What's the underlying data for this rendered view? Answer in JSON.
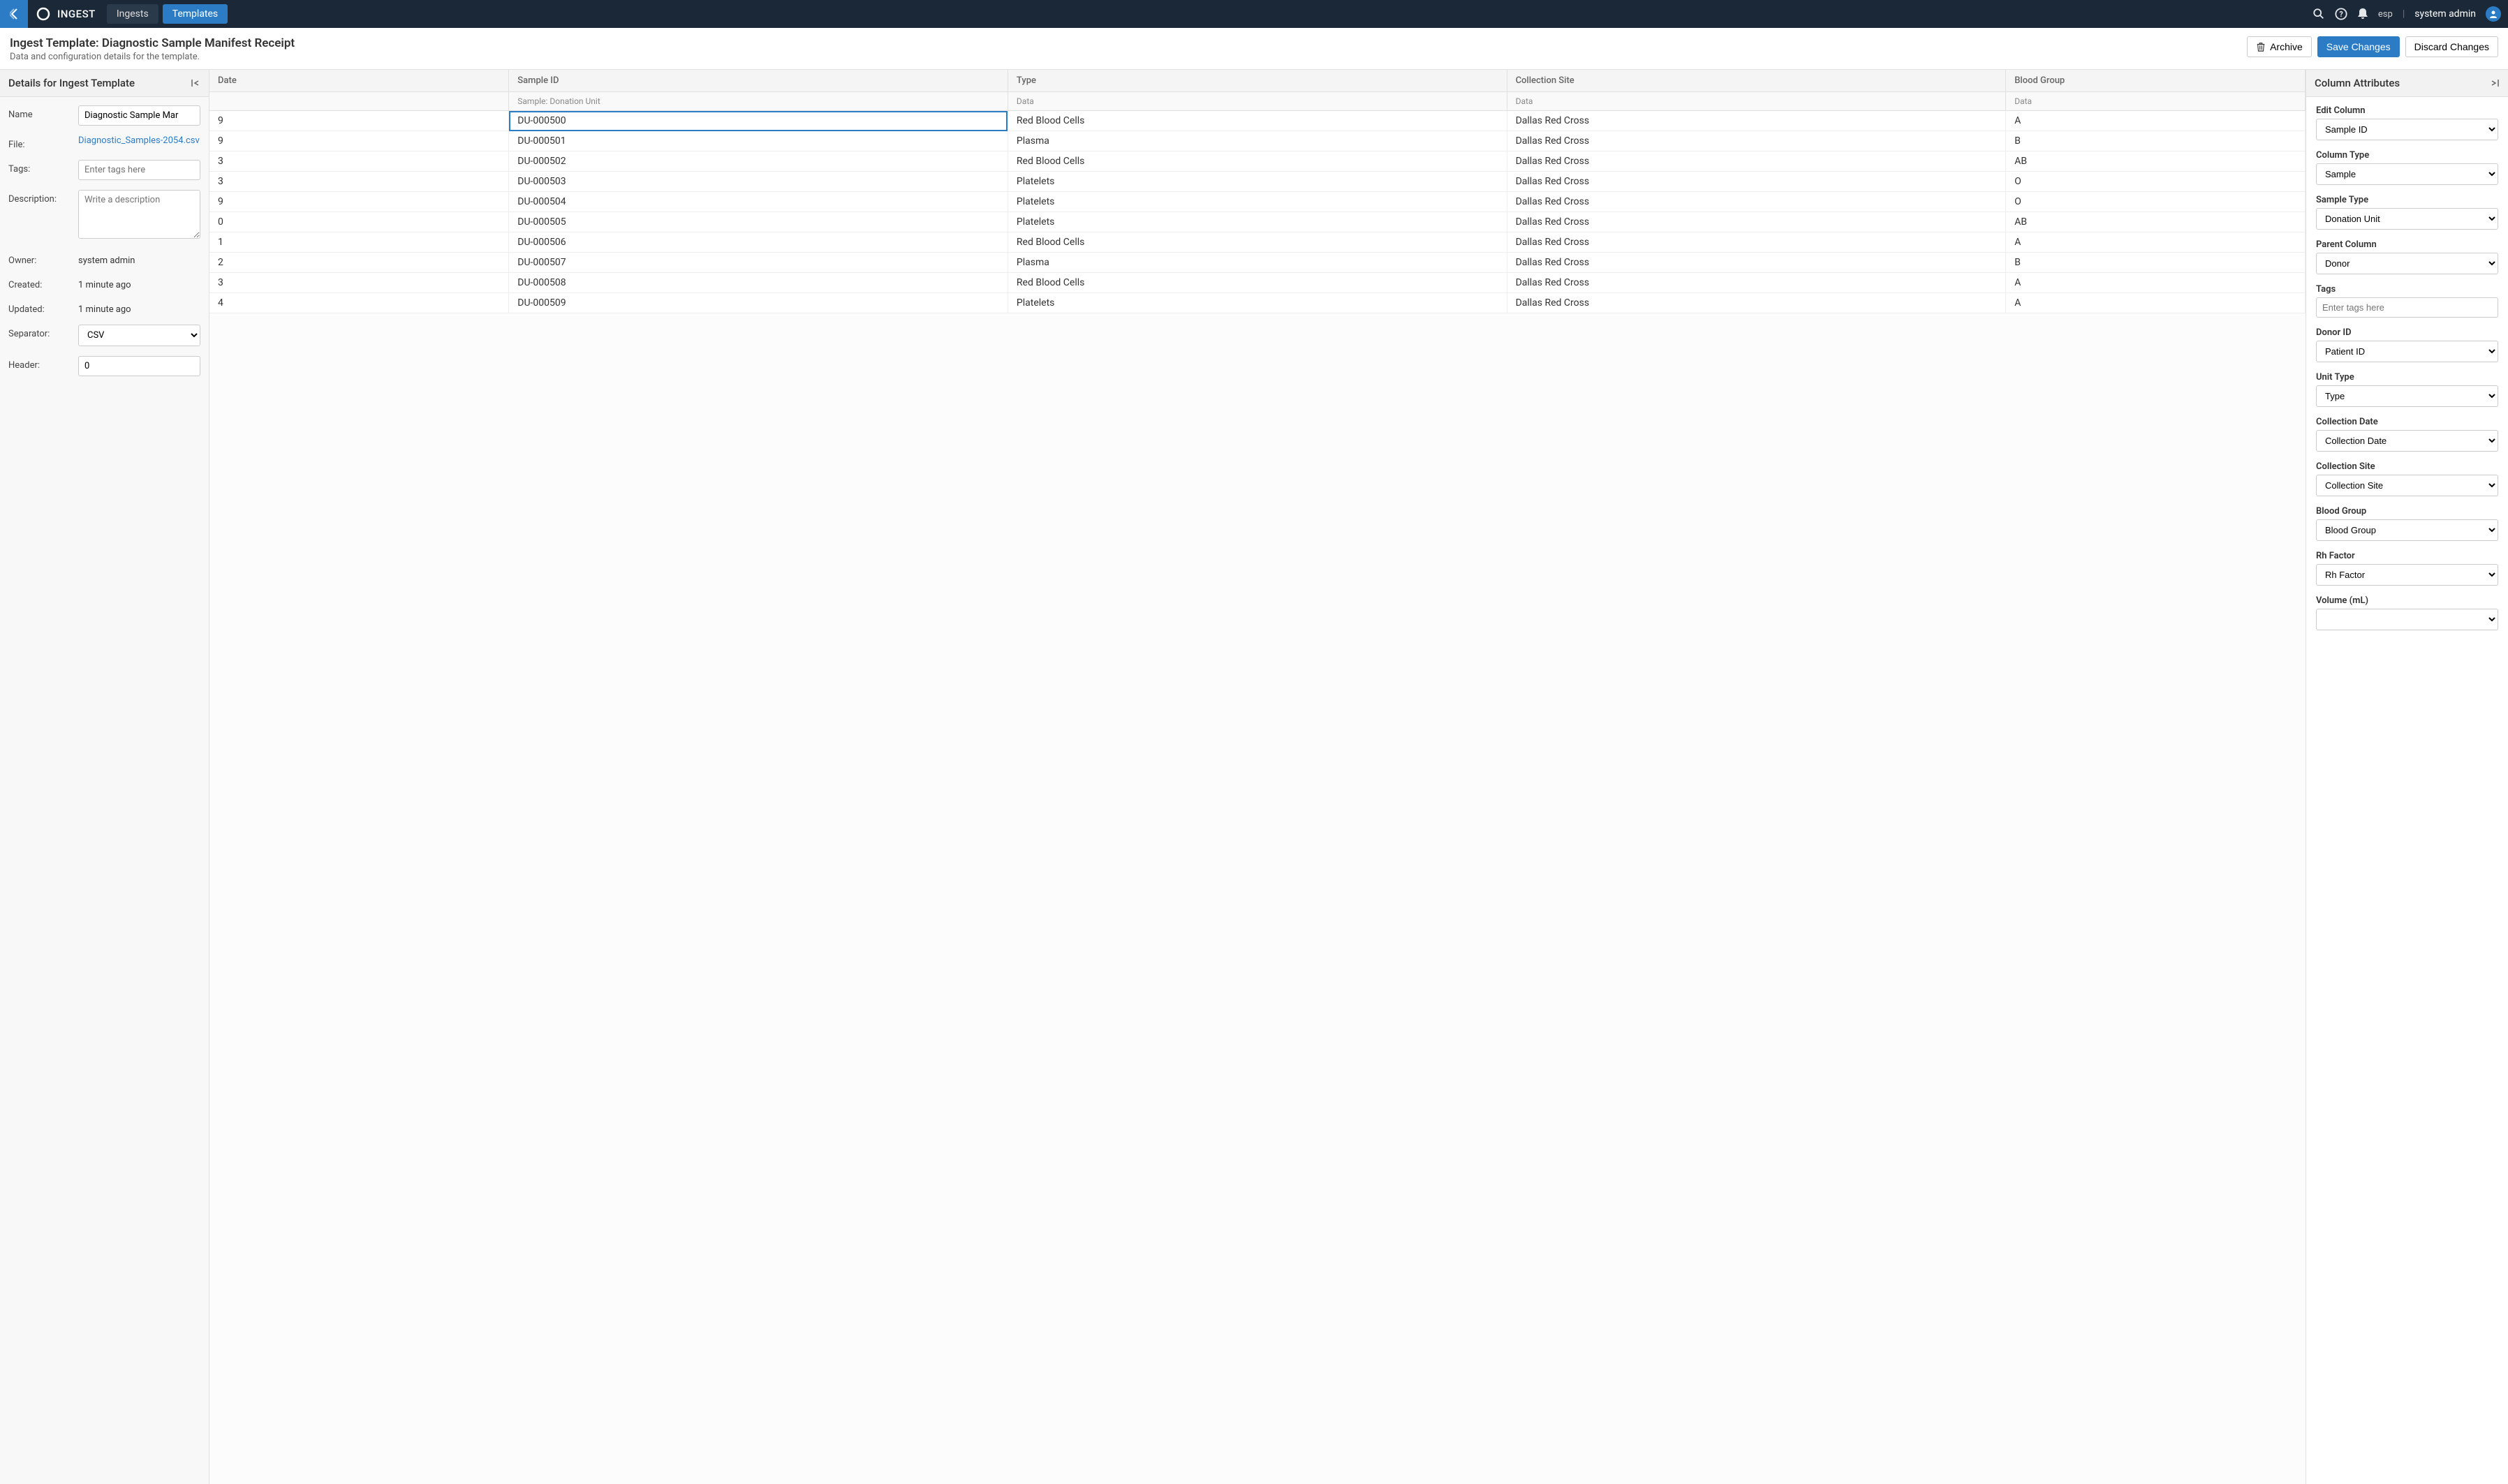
{
  "topbar": {
    "app_name": "INGEST",
    "tabs": {
      "ingests": "Ingests",
      "templates": "Templates"
    },
    "lang": "esp",
    "user": "system admin"
  },
  "page": {
    "title": "Ingest Template: Diagnostic Sample Manifest Receipt",
    "subtitle": "Data and configuration details for the template."
  },
  "buttons": {
    "archive": "Archive",
    "save": "Save Changes",
    "discard": "Discard Changes"
  },
  "left_panel": {
    "header": "Details for Ingest Template",
    "labels": {
      "name": "Name",
      "file": "File:",
      "tags": "Tags:",
      "description": "Description:",
      "owner": "Owner:",
      "created": "Created:",
      "updated": "Updated:",
      "separator": "Separator:",
      "header": "Header:"
    },
    "name_value": "Diagnostic Sample Mar",
    "file_value": "Diagnostic_Samples-2054.csv",
    "tags_placeholder": "Enter tags here",
    "description_placeholder": "Write a description",
    "owner_value": "system admin",
    "created_value": "1 minute ago",
    "updated_value": "1 minute ago",
    "separator_value": "CSV",
    "header_value": "0"
  },
  "grid": {
    "columns": [
      {
        "name": "Date",
        "sub": ""
      },
      {
        "name": "Sample ID",
        "sub": "Sample: Donation Unit"
      },
      {
        "name": "Type",
        "sub": "Data"
      },
      {
        "name": "Collection Site",
        "sub": "Data"
      },
      {
        "name": "Blood Group",
        "sub": "Data"
      }
    ],
    "rows": [
      {
        "date_suffix": "9",
        "sample_id": "DU-000500",
        "type": "Red Blood Cells",
        "site": "Dallas Red Cross",
        "bg": "A"
      },
      {
        "date_suffix": "9",
        "sample_id": "DU-000501",
        "type": "Plasma",
        "site": "Dallas Red Cross",
        "bg": "B"
      },
      {
        "date_suffix": "3",
        "sample_id": "DU-000502",
        "type": "Red Blood Cells",
        "site": "Dallas Red Cross",
        "bg": "AB"
      },
      {
        "date_suffix": "3",
        "sample_id": "DU-000503",
        "type": "Platelets",
        "site": "Dallas Red Cross",
        "bg": "O"
      },
      {
        "date_suffix": "9",
        "sample_id": "DU-000504",
        "type": "Platelets",
        "site": "Dallas Red Cross",
        "bg": "O"
      },
      {
        "date_suffix": "0",
        "sample_id": "DU-000505",
        "type": "Platelets",
        "site": "Dallas Red Cross",
        "bg": "AB"
      },
      {
        "date_suffix": "1",
        "sample_id": "DU-000506",
        "type": "Red Blood Cells",
        "site": "Dallas Red Cross",
        "bg": "A"
      },
      {
        "date_suffix": "2",
        "sample_id": "DU-000507",
        "type": "Plasma",
        "site": "Dallas Red Cross",
        "bg": "B"
      },
      {
        "date_suffix": "3",
        "sample_id": "DU-000508",
        "type": "Red Blood Cells",
        "site": "Dallas Red Cross",
        "bg": "A"
      },
      {
        "date_suffix": "4",
        "sample_id": "DU-000509",
        "type": "Platelets",
        "site": "Dallas Red Cross",
        "bg": "A"
      }
    ]
  },
  "right_panel": {
    "header": "Column Attributes",
    "fields": [
      {
        "label": "Edit Column",
        "value": "Sample ID",
        "type": "select"
      },
      {
        "label": "Column Type",
        "value": "Sample",
        "type": "select"
      },
      {
        "label": "Sample Type",
        "value": "Donation Unit",
        "type": "select"
      },
      {
        "label": "Parent Column",
        "value": "Donor",
        "type": "select"
      },
      {
        "label": "Tags",
        "value": "",
        "type": "input",
        "placeholder": "Enter tags here"
      },
      {
        "label": "Donor ID",
        "value": "Patient ID",
        "type": "select"
      },
      {
        "label": "Unit Type",
        "value": "Type",
        "type": "select"
      },
      {
        "label": "Collection Date",
        "value": "Collection Date",
        "type": "select"
      },
      {
        "label": "Collection Site",
        "value": "Collection Site",
        "type": "select"
      },
      {
        "label": "Blood Group",
        "value": "Blood Group",
        "type": "select"
      },
      {
        "label": "Rh Factor",
        "value": "Rh Factor",
        "type": "select"
      },
      {
        "label": "Volume (mL)",
        "value": "",
        "type": "select"
      }
    ]
  }
}
